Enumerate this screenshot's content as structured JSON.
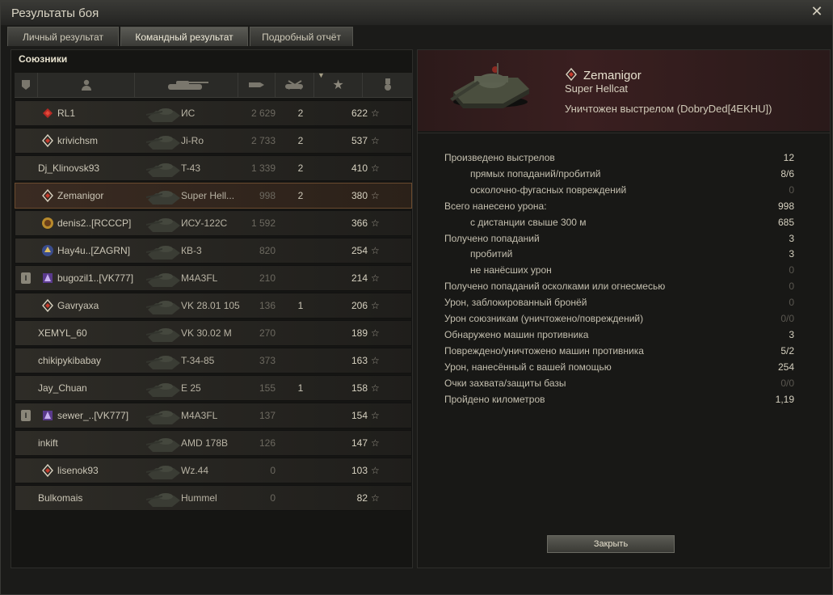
{
  "window": {
    "title": "Результаты боя"
  },
  "tabs": [
    {
      "label": "Личный результат"
    },
    {
      "label": "Командный результат"
    },
    {
      "label": "Подробный отчёт"
    }
  ],
  "left": {
    "section": "Союзники"
  },
  "players": [
    {
      "name": "RL1",
      "vehicle": "ИС",
      "damage": "2 629",
      "kills": "2",
      "xp": "622",
      "clan": "red",
      "platoon": ""
    },
    {
      "name": "krivichsm",
      "vehicle": "Ji-Ro",
      "damage": "2 733",
      "kills": "2",
      "xp": "537",
      "clan": "diamond",
      "platoon": ""
    },
    {
      "name": "Dj_Klinovsk93",
      "vehicle": "T-43",
      "damage": "1 339",
      "kills": "2",
      "xp": "410",
      "clan": "",
      "platoon": ""
    },
    {
      "name": "Zemanigor",
      "vehicle": "Super Hell...",
      "damage": "998",
      "kills": "2",
      "xp": "380",
      "clan": "diamond",
      "platoon": ""
    },
    {
      "name": "denis2..[RCCCP]",
      "vehicle": "ИСУ-122С",
      "damage": "1 592",
      "kills": "",
      "xp": "366",
      "clan": "gold",
      "platoon": ""
    },
    {
      "name": "Hay4u..[ZAGRN]",
      "vehicle": "КВ-3",
      "damage": "820",
      "kills": "",
      "xp": "254",
      "clan": "blue",
      "platoon": ""
    },
    {
      "name": "bugozil1..[VK777]",
      "vehicle": "M4A3FL",
      "damage": "210",
      "kills": "",
      "xp": "214",
      "clan": "purple",
      "platoon": "I"
    },
    {
      "name": "Gavryaxa",
      "vehicle": "VK 28.01 105",
      "damage": "136",
      "kills": "1",
      "xp": "206",
      "clan": "diamond",
      "platoon": ""
    },
    {
      "name": "XEMYL_60",
      "vehicle": "VK 30.02 M",
      "damage": "270",
      "kills": "",
      "xp": "189",
      "clan": "",
      "platoon": ""
    },
    {
      "name": "chikipykibabay",
      "vehicle": "T-34-85",
      "damage": "373",
      "kills": "",
      "xp": "163",
      "clan": "",
      "platoon": ""
    },
    {
      "name": "Jay_Chuan",
      "vehicle": "E 25",
      "damage": "155",
      "kills": "1",
      "xp": "158",
      "clan": "",
      "platoon": ""
    },
    {
      "name": "sewer_..[VK777]",
      "vehicle": "M4A3FL",
      "damage": "137",
      "kills": "",
      "xp": "154",
      "clan": "purple",
      "platoon": "I"
    },
    {
      "name": "inkift",
      "vehicle": "AMD 178B",
      "damage": "126",
      "kills": "",
      "xp": "147",
      "clan": "",
      "platoon": ""
    },
    {
      "name": "lisenok93",
      "vehicle": "Wz.44",
      "damage": "0",
      "kills": "",
      "xp": "103",
      "clan": "diamond",
      "platoon": ""
    },
    {
      "name": "Bulkomais",
      "vehicle": "Hummel",
      "damage": "0",
      "kills": "",
      "xp": "82",
      "clan": "",
      "platoon": ""
    }
  ],
  "detail": {
    "player": "Zemanigor",
    "tank": "Super Hellcat",
    "destroyed": "Уничтожен выстрелом (DobryDed[4EKHU])",
    "stats": [
      {
        "label": "Произведено выстрелов",
        "value": "12",
        "indent": false,
        "dim": false
      },
      {
        "label": "прямых попаданий/пробитий",
        "value": "8/6",
        "indent": true,
        "dim": false
      },
      {
        "label": "осколочно-фугасных повреждений",
        "value": "0",
        "indent": true,
        "dim": true
      },
      {
        "label": "Всего нанесено урона:",
        "value": "998",
        "indent": false,
        "dim": false
      },
      {
        "label": "с дистанции свыше 300 м",
        "value": "685",
        "indent": true,
        "dim": false
      },
      {
        "label": "Получено попаданий",
        "value": "3",
        "indent": false,
        "dim": false
      },
      {
        "label": "пробитий",
        "value": "3",
        "indent": true,
        "dim": false
      },
      {
        "label": "не нанёсших урон",
        "value": "0",
        "indent": true,
        "dim": true
      },
      {
        "label": "Получено попаданий осколками или огнесмесью",
        "value": "0",
        "indent": false,
        "dim": true
      },
      {
        "label": "Урон, заблокированный бронёй",
        "value": "0",
        "indent": false,
        "dim": true
      },
      {
        "label": "Урон союзникам (уничтожено/повреждений)",
        "value": "0/0",
        "indent": false,
        "dim": true
      },
      {
        "label": "Обнаружено машин противника",
        "value": "3",
        "indent": false,
        "dim": false
      },
      {
        "label": "Повреждено/уничтожено машин противника",
        "value": "5/2",
        "indent": false,
        "dim": false
      },
      {
        "label": "Урон, нанесённый с вашей помощью",
        "value": "254",
        "indent": false,
        "dim": false
      },
      {
        "label": "Очки захвата/защиты базы",
        "value": "0/0",
        "indent": false,
        "dim": true
      },
      {
        "label": "Пройдено километров",
        "value": "1,19",
        "indent": false,
        "dim": false
      }
    ],
    "close_label": "Закрыть"
  },
  "icons": {
    "close": "close-icon",
    "star": "star-icon",
    "platoon": "platoon-icon",
    "tank": "tank-icon"
  }
}
